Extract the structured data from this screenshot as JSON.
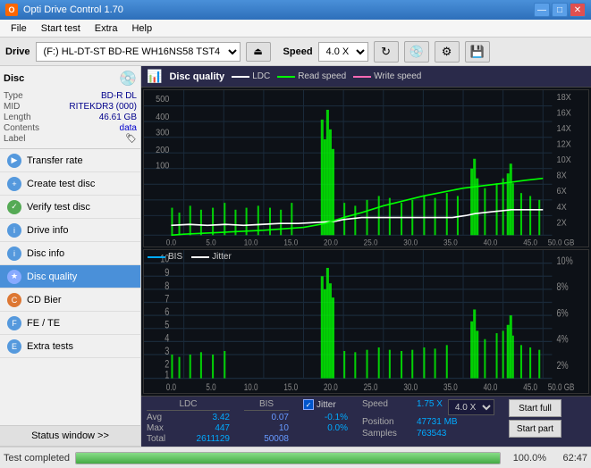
{
  "titlebar": {
    "icon": "O",
    "title": "Opti Drive Control 1.70",
    "minimize": "—",
    "maximize": "□",
    "close": "✕"
  },
  "menubar": {
    "items": [
      "File",
      "Start test",
      "Extra",
      "Help"
    ]
  },
  "drivebar": {
    "drive_label": "Drive",
    "drive_value": "(F:)  HL-DT-ST BD-RE  WH16NS58 TST4",
    "speed_label": "Speed",
    "speed_value": "4.0 X"
  },
  "disc": {
    "title": "Disc",
    "type_label": "Type",
    "type_value": "BD-R DL",
    "mid_label": "MID",
    "mid_value": "RITEKDR3 (000)",
    "length_label": "Length",
    "length_value": "46.61 GB",
    "contents_label": "Contents",
    "contents_value": "data",
    "label_label": "Label"
  },
  "nav": {
    "items": [
      {
        "id": "transfer-rate",
        "label": "Transfer rate",
        "active": false
      },
      {
        "id": "create-test-disc",
        "label": "Create test disc",
        "active": false
      },
      {
        "id": "verify-test-disc",
        "label": "Verify test disc",
        "active": false
      },
      {
        "id": "drive-info",
        "label": "Drive info",
        "active": false
      },
      {
        "id": "disc-info",
        "label": "Disc info",
        "active": false
      },
      {
        "id": "disc-quality",
        "label": "Disc quality",
        "active": true
      },
      {
        "id": "cd-bier",
        "label": "CD Bier",
        "active": false
      },
      {
        "id": "fe-te",
        "label": "FE / TE",
        "active": false
      },
      {
        "id": "extra-tests",
        "label": "Extra tests",
        "active": false
      }
    ],
    "status_window": "Status window >>"
  },
  "chart": {
    "title": "Disc quality",
    "legend": {
      "ldc": "LDC",
      "read_speed": "Read speed",
      "write_speed": "Write speed"
    },
    "bottom_legend": {
      "bis": "BIS",
      "jitter": "Jitter"
    },
    "top_y_right": [
      "18X",
      "16X",
      "14X",
      "12X",
      "10X",
      "8X",
      "6X",
      "4X",
      "2X"
    ],
    "bottom_y_right": [
      "10%",
      "8%",
      "6%",
      "4%",
      "2%"
    ],
    "x_labels": [
      "0.0",
      "5.0",
      "10.0",
      "15.0",
      "20.0",
      "25.0",
      "30.0",
      "35.0",
      "40.0",
      "45.0",
      "50.0 GB"
    ]
  },
  "stats": {
    "ldc_header": "LDC",
    "bis_header": "BIS",
    "jitter_header": "Jitter",
    "avg_label": "Avg",
    "max_label": "Max",
    "total_label": "Total",
    "ldc_avg": "3.42",
    "ldc_max": "447",
    "ldc_total": "2611129",
    "bis_avg": "0.07",
    "bis_max": "10",
    "bis_total": "50008",
    "jitter_avg": "-0.1%",
    "jitter_max": "0.0%",
    "speed_label": "Speed",
    "speed_value": "1.75 X",
    "speed_select": "4.0 X",
    "position_label": "Position",
    "position_value": "47731 MB",
    "samples_label": "Samples",
    "samples_value": "763543",
    "start_full": "Start full",
    "start_part": "Start part"
  },
  "statusbar": {
    "status_text": "Test completed",
    "progress": "100.0%",
    "time": "62:47"
  }
}
